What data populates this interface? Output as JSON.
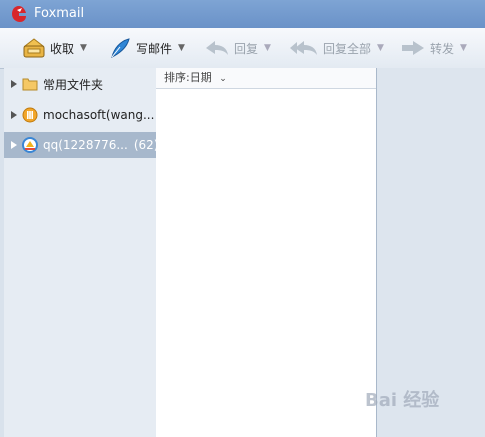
{
  "window": {
    "title": "Foxmail"
  },
  "toolbar": {
    "receive": "收取",
    "compose": "写邮件",
    "reply": "回复",
    "reply_all": "回复全部",
    "forward": "转发"
  },
  "sidebar": {
    "items": [
      {
        "label": "常用文件夹",
        "count": ""
      },
      {
        "label": "mochasoft(wang...",
        "count": ""
      },
      {
        "label": "qq(1228776...",
        "count": "(62)"
      }
    ]
  },
  "list": {
    "sort_label": "排序:日期"
  },
  "watermark": {
    "text": "Bai 经验"
  },
  "colors": {
    "accent": "#6a92c8",
    "selected": "#a7b8cc"
  }
}
